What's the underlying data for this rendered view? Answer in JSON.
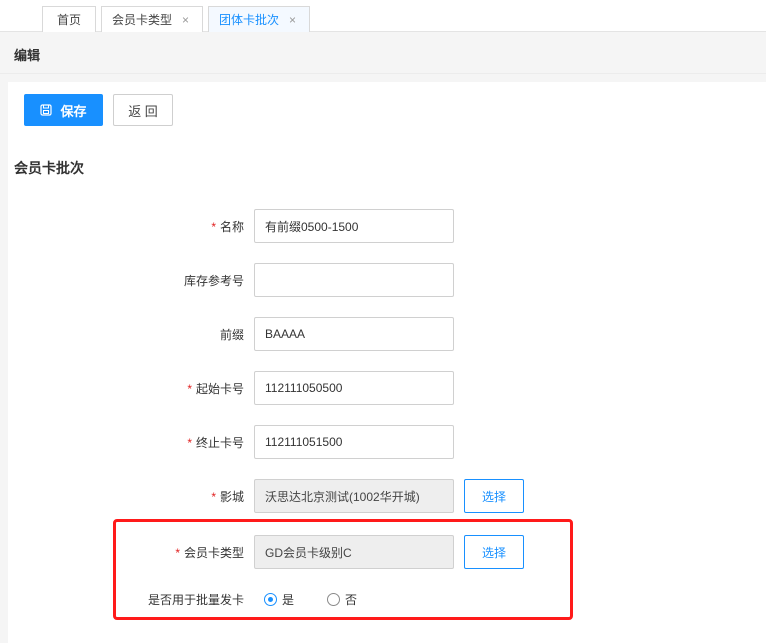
{
  "tabs": [
    {
      "label": "首页",
      "closable": false,
      "active": false
    },
    {
      "label": "会员卡类型",
      "closable": true,
      "active": false
    },
    {
      "label": "团体卡批次",
      "closable": true,
      "active": true
    }
  ],
  "tab_close_glyph": "×",
  "page_title": "编辑",
  "toolbar": {
    "save_label": "保存",
    "save_icon": "save-icon",
    "back_label": "返 回"
  },
  "section_title": "会员卡批次",
  "required_mark": "*",
  "form": {
    "name": {
      "label": "名称",
      "value": "有前缀0500-1500",
      "required": true
    },
    "stock_ref": {
      "label": "库存参考号",
      "value": "",
      "required": false
    },
    "prefix": {
      "label": "前缀",
      "value": "BAAAA",
      "required": false
    },
    "start_no": {
      "label": "起始卡号",
      "value": "112111050500",
      "required": true
    },
    "end_no": {
      "label": "终止卡号",
      "value": "112111051500",
      "required": true
    },
    "cinema": {
      "label": "影城",
      "value": "沃思达北京测试(1002华开城)",
      "required": true,
      "button_label": "选择"
    },
    "card_type": {
      "label": "会员卡类型",
      "value": "GD会员卡级别C",
      "required": true,
      "button_label": "选择"
    },
    "batch_issue": {
      "label": "是否用于批量发卡",
      "options": [
        "是",
        "否"
      ],
      "selected": "是"
    }
  },
  "colors": {
    "primary": "#1890ff",
    "highlight": "#ff1a1a",
    "required": "#e02020"
  }
}
